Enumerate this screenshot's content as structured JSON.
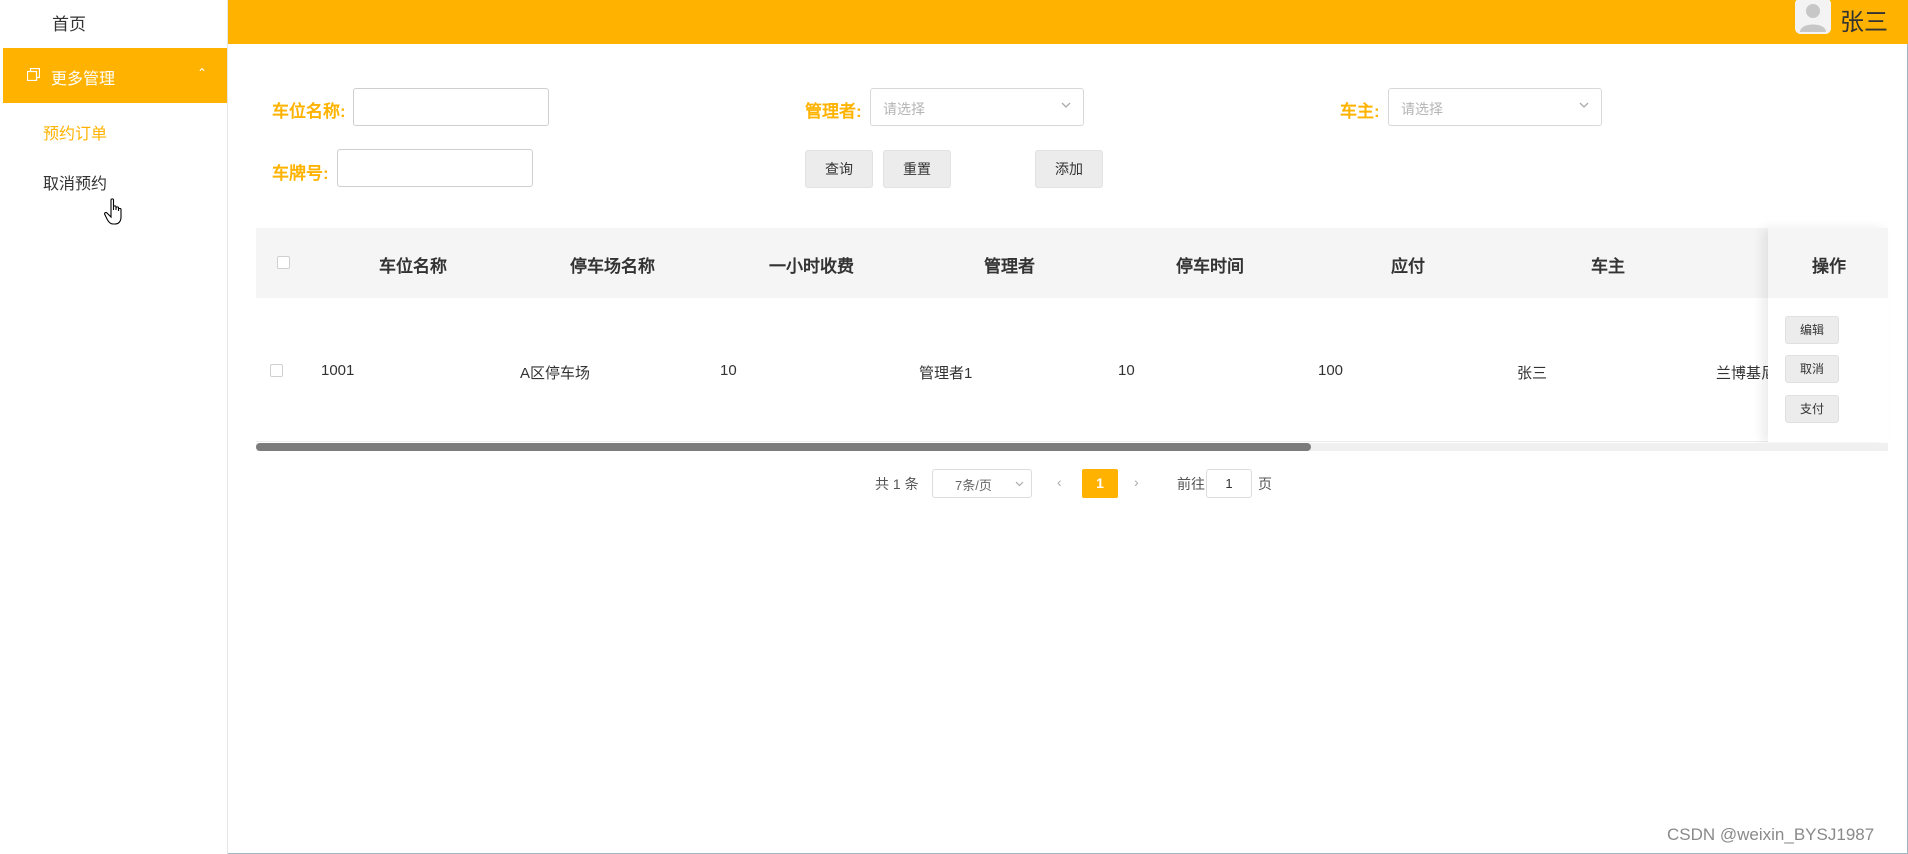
{
  "sidebar": {
    "home_label": "首页",
    "group_label": "更多管理",
    "items": [
      {
        "label": "预约订单",
        "active": true
      },
      {
        "label": "取消预约",
        "active": false
      }
    ]
  },
  "header": {
    "username": "张三",
    "accent_color": "#ffb300"
  },
  "search": {
    "space_name_label": "车位名称:",
    "space_name_value": "",
    "manager_label": "管理者:",
    "manager_placeholder": "请选择",
    "owner_label": "车主:",
    "owner_placeholder": "请选择",
    "plate_label": "车牌号:",
    "plate_value": "",
    "query_button": "查询",
    "reset_button": "重置",
    "add_button": "添加"
  },
  "table": {
    "columns": [
      "车位名称",
      "停车场名称",
      "一小时收费",
      "管理者",
      "停车时间",
      "应付",
      "车主",
      "操作"
    ],
    "rows": [
      {
        "space_name": "1001",
        "lot_name": "A区停车场",
        "hourly_fee": "10",
        "manager": "管理者1",
        "parking_time": "10",
        "payable": "100",
        "owner": "张三",
        "extra": "兰博基尼",
        "actions": [
          "编辑",
          "取消",
          "支付"
        ]
      }
    ]
  },
  "pagination": {
    "total_text": "共 1 条",
    "page_size": "7条/页",
    "current_page": "1",
    "goto_label": "前往",
    "goto_value": "1",
    "page_suffix": "页"
  },
  "watermark": "CSDN @weixin_BYSJ1987"
}
